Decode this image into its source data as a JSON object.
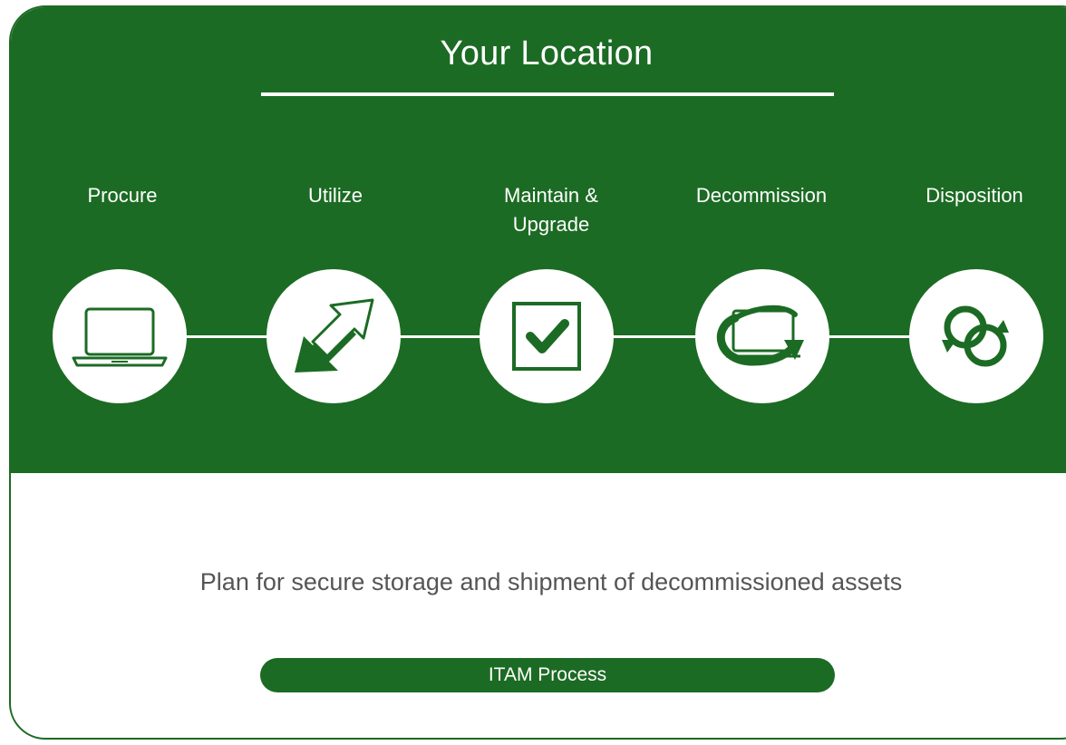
{
  "title": "Your Location",
  "stages": [
    {
      "label": "Procure",
      "icon": "laptop-icon"
    },
    {
      "label": "Utilize",
      "icon": "swap-arrows-icon"
    },
    {
      "label": "Maintain & Upgrade",
      "icon": "checkbox-icon"
    },
    {
      "label": "Decommission",
      "icon": "laptop-cycle-icon"
    },
    {
      "label": "Disposition",
      "icon": "recycle-rings-icon"
    }
  ],
  "description": "Plan for secure storage and shipment of decommissioned assets",
  "process_label": "ITAM Process",
  "colors": {
    "brand_green": "#1c6b24",
    "text_gray": "#555555",
    "white": "#ffffff"
  }
}
